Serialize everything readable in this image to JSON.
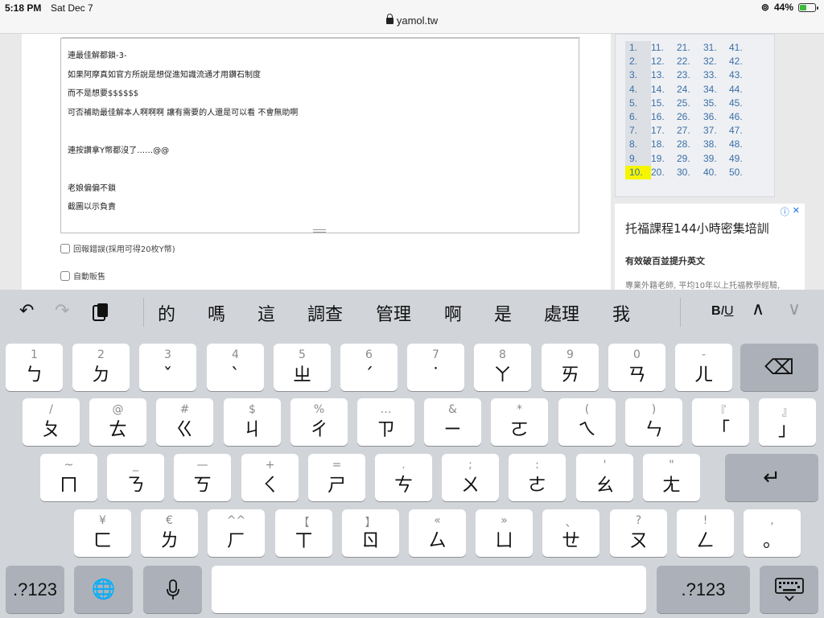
{
  "status": {
    "time": "5:18 PM",
    "date": "Sat Dec 7",
    "battery": "44%",
    "battery_level": 0.44,
    "url": "yamol.tw"
  },
  "editor": {
    "lines": [
      "連最佳解都鎖-3-",
      "如果阿摩真如官方所說是想促進知識流通才用鑽石制度",
      "而不是想要$$$$$$",
      "可否補助最佳解本人啊啊啊 讓有需要的人還是可以看 不會無助啊",
      "",
      "連按讚拿Y幣都沒了……@@",
      "",
      "老娘偏偏不鎖",
      "截圖以示負責"
    ]
  },
  "options": {
    "report_error": "回報錯誤(採用可得20枚Y幣)",
    "auto_sell": "自動販售"
  },
  "sidebar": {
    "numbers": [
      "1.",
      "11.",
      "21.",
      "31.",
      "41.",
      "2.",
      "12.",
      "22.",
      "32.",
      "42.",
      "3.",
      "13.",
      "23.",
      "33.",
      "43.",
      "4.",
      "14.",
      "24.",
      "34.",
      "44.",
      "5.",
      "15.",
      "25.",
      "35.",
      "45.",
      "6.",
      "16.",
      "26.",
      "36.",
      "46.",
      "7.",
      "17.",
      "27.",
      "37.",
      "47.",
      "8.",
      "18.",
      "28.",
      "38.",
      "48.",
      "9.",
      "19.",
      "29.",
      "39.",
      "49.",
      "10.",
      "20.",
      "30.",
      "40.",
      "50."
    ],
    "highlighted": "10."
  },
  "ad": {
    "title": "托福課程144小時密集培訓",
    "subtitle": "有效破百並提升英文",
    "body": "專業外籍老師, 平均10年以上托福教學經驗,",
    "info_icon": "ⓘ",
    "close_icon": "✕"
  },
  "keyboard": {
    "suggestions": [
      "的",
      "嗎",
      "這",
      "調查",
      "管理",
      "啊",
      "是",
      "處理",
      "我"
    ],
    "icons": {
      "undo": "↶",
      "redo": "↷",
      "paste": "clipboard-icon",
      "up": "∧",
      "down": "∨"
    },
    "format_b": "B",
    "format_i": "I",
    "format_u": "U",
    "rows": [
      [
        {
          "hint": "1",
          "main": "ㄅ"
        },
        {
          "hint": "2",
          "main": "ㄉ"
        },
        {
          "hint": "3",
          "main": "ˇ"
        },
        {
          "hint": "4",
          "main": "ˋ"
        },
        {
          "hint": "5",
          "main": "ㄓ"
        },
        {
          "hint": "6",
          "main": "ˊ"
        },
        {
          "hint": "7",
          "main": "˙"
        },
        {
          "hint": "8",
          "main": "ㄚ"
        },
        {
          "hint": "9",
          "main": "ㄞ"
        },
        {
          "hint": "0",
          "main": "ㄢ"
        },
        {
          "hint": "-",
          "main": "ㄦ"
        }
      ],
      [
        {
          "hint": "/",
          "main": "ㄆ"
        },
        {
          "hint": "@",
          "main": "ㄊ"
        },
        {
          "hint": "#",
          "main": "ㄍ"
        },
        {
          "hint": "$",
          "main": "ㄐ"
        },
        {
          "hint": "%",
          "main": "ㄔ"
        },
        {
          "hint": "…",
          "main": "ㄗ"
        },
        {
          "hint": "&",
          "main": "ㄧ"
        },
        {
          "hint": "*",
          "main": "ㄛ"
        },
        {
          "hint": "(",
          "main": "ㄟ"
        },
        {
          "hint": ")",
          "main": "ㄣ"
        },
        {
          "hint": "『",
          "main": "「"
        },
        {
          "hint": "』",
          "main": "」"
        }
      ],
      [
        {
          "hint": "~",
          "main": "ㄇ"
        },
        {
          "hint": "_",
          "main": "ㄋ"
        },
        {
          "hint": "—",
          "main": "ㄎ"
        },
        {
          "hint": "+",
          "main": "ㄑ"
        },
        {
          "hint": "=",
          "main": "ㄕ"
        },
        {
          "hint": ".",
          "main": "ㄘ"
        },
        {
          "hint": ";",
          "main": "ㄨ"
        },
        {
          "hint": ":",
          "main": "ㄜ"
        },
        {
          "hint": "'",
          "main": "ㄠ"
        },
        {
          "hint": "\"",
          "main": "ㄤ"
        }
      ],
      [
        {
          "hint": "¥",
          "main": "ㄈ"
        },
        {
          "hint": "€",
          "main": "ㄌ"
        },
        {
          "hint": "^^",
          "main": "ㄏ"
        },
        {
          "hint": "【",
          "main": "ㄒ"
        },
        {
          "hint": "】",
          "main": "ㄖ"
        },
        {
          "hint": "«",
          "main": "ㄙ"
        },
        {
          "hint": "»",
          "main": "ㄩ"
        },
        {
          "hint": "、",
          "main": "ㄝ"
        },
        {
          "hint": "?",
          "main": "ㄡ"
        },
        {
          "hint": "!",
          "main": "ㄥ"
        },
        {
          "hint": ",",
          "main": "。"
        }
      ]
    ],
    "backspace": "⌫",
    "return": "↵",
    "numbers_left": ".?123",
    "numbers_right": ".?123",
    "globe": "🌐",
    "mic": "mic-icon",
    "hide": "keyboard-hide-icon"
  }
}
